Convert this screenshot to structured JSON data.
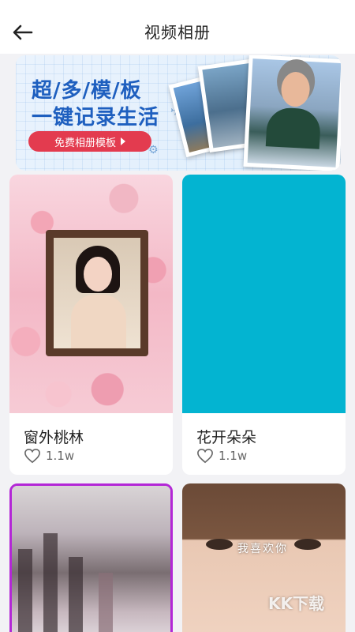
{
  "header": {
    "title": "视频相册"
  },
  "banner": {
    "line1": "超/多/模/板",
    "line2": "一键记录生活",
    "button_label": "免费相册模板"
  },
  "cards": [
    {
      "title": "窗外桃林",
      "likes": "1.1w"
    },
    {
      "title": "花开朵朵",
      "likes": "1.1w"
    },
    {
      "title": "",
      "likes": ""
    },
    {
      "title": "",
      "likes": ""
    }
  ],
  "card4_overlay_text": "我喜欢你",
  "watermark": "KK下载",
  "colors": {
    "banner_button": "#e33b4f",
    "banner_text": "#1e5fbf",
    "card2_fill": "#03b4d1",
    "card3_border": "#b327d6"
  }
}
